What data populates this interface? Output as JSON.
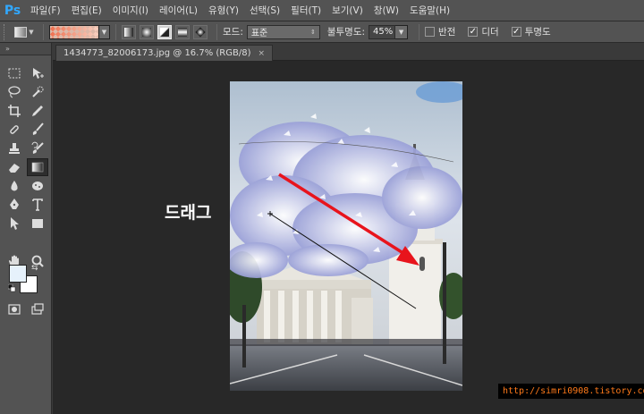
{
  "app": {
    "logo": "Ps",
    "accent": "#31a8ff"
  },
  "menu": [
    {
      "label": "파일(F)"
    },
    {
      "label": "편집(E)"
    },
    {
      "label": "이미지(I)"
    },
    {
      "label": "레이어(L)"
    },
    {
      "label": "유형(Y)"
    },
    {
      "label": "선택(S)"
    },
    {
      "label": "필터(T)"
    },
    {
      "label": "보기(V)"
    },
    {
      "label": "창(W)"
    },
    {
      "label": "도움말(H)"
    }
  ],
  "options": {
    "gradient_types": [
      "linear-gradient-icon",
      "radial-gradient-icon",
      "angle-gradient-icon",
      "reflected-gradient-icon",
      "diamond-gradient-icon"
    ],
    "active_gradient_type": 2,
    "mode_label": "모드:",
    "mode_value": "표준",
    "opacity_label": "불투명도:",
    "opacity_value": "45%",
    "reverse_label": "반전",
    "reverse_checked": false,
    "dither_label": "디더",
    "dither_checked": true,
    "transparency_label": "투명도",
    "transparency_checked": true
  },
  "document": {
    "tab_title": "1434773_82006173.jpg @ 16.7% (RGB/8)",
    "close_glyph": "×"
  },
  "canvas": {
    "annotation_text": "드래그",
    "url_text": "http://simri0908.tistory.com"
  },
  "colors": {
    "foreground": "#e6f1fb",
    "background": "#ffffff",
    "arrow": "#e8141c"
  }
}
